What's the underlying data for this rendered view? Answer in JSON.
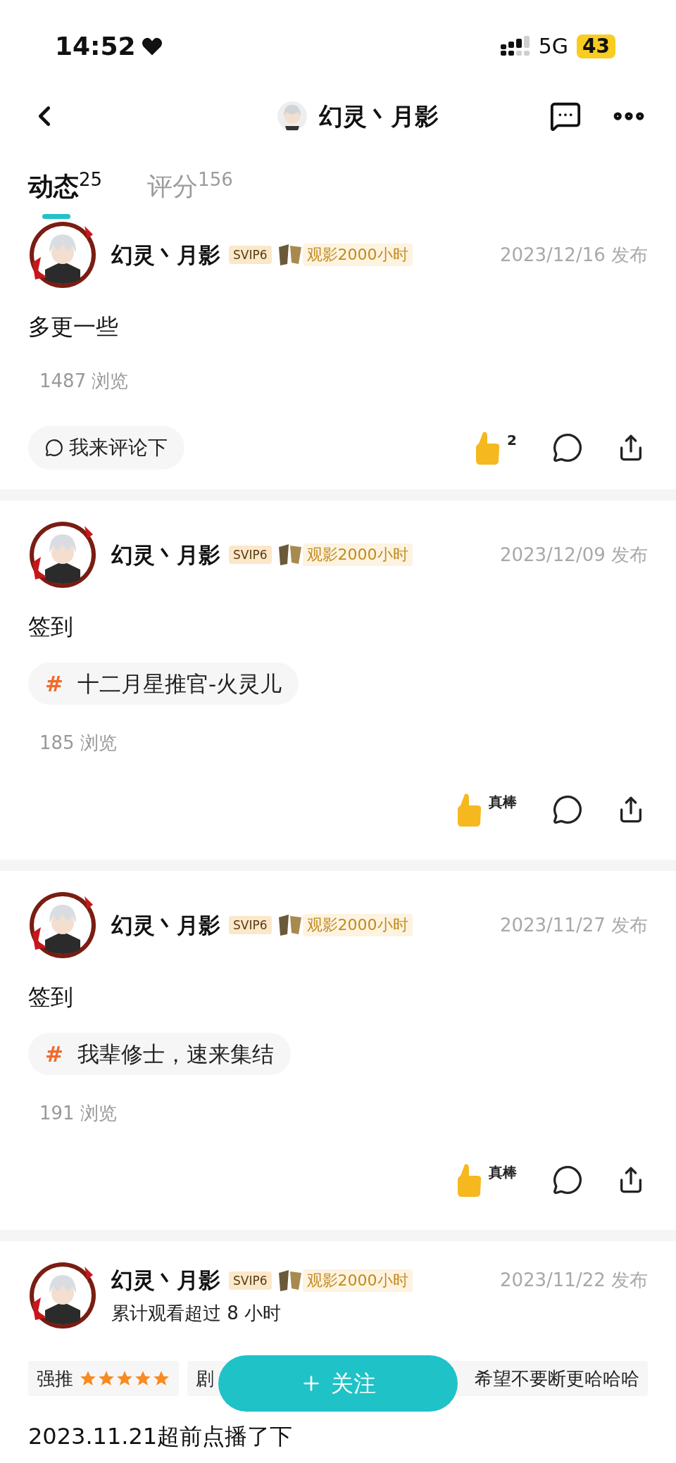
{
  "status_bar": {
    "time": "14:52",
    "network": "5G",
    "battery": "43"
  },
  "nav": {
    "title": "幻灵丶月影"
  },
  "tabs": [
    {
      "label": "动态",
      "count": "25",
      "selected": true
    },
    {
      "label": "评分",
      "count": "156",
      "selected": false
    }
  ],
  "posts": [
    {
      "author": "幻灵丶月影",
      "vip": "SVIP6",
      "watch_badge": "观影2000小时",
      "date": "2023/12/16 发布",
      "text": "多更一些",
      "views": "1487 浏览",
      "comment_prompt": "我来评论下",
      "likes": "2"
    },
    {
      "author": "幻灵丶月影",
      "vip": "SVIP6",
      "watch_badge": "观影2000小时",
      "date": "2023/12/09 发布",
      "text": "签到",
      "tag": {
        "mark": "#",
        "label": "十二月星推官-火灵儿"
      },
      "views": "185 浏览",
      "likes": "真棒"
    },
    {
      "author": "幻灵丶月影",
      "vip": "SVIP6",
      "watch_badge": "观影2000小时",
      "date": "2023/11/27 发布",
      "text": "签到",
      "tag": {
        "mark": "#",
        "label": "我辈修士，速来集结"
      },
      "views": "191 浏览",
      "likes": "真棒"
    },
    {
      "author": "幻灵丶月影",
      "vip": "SVIP6",
      "watch_badge": "观影2000小时",
      "date": "2023/11/22 发布",
      "subtitle": "累计观看超过 8 小时",
      "review": {
        "rating_label": "强推",
        "stars": 5,
        "chip_start": "剧",
        "chip_end": "希望不要断更哈哈哈"
      },
      "text": "2023.11.21超前点播了下"
    }
  ],
  "follow_button": {
    "label": "关注"
  }
}
